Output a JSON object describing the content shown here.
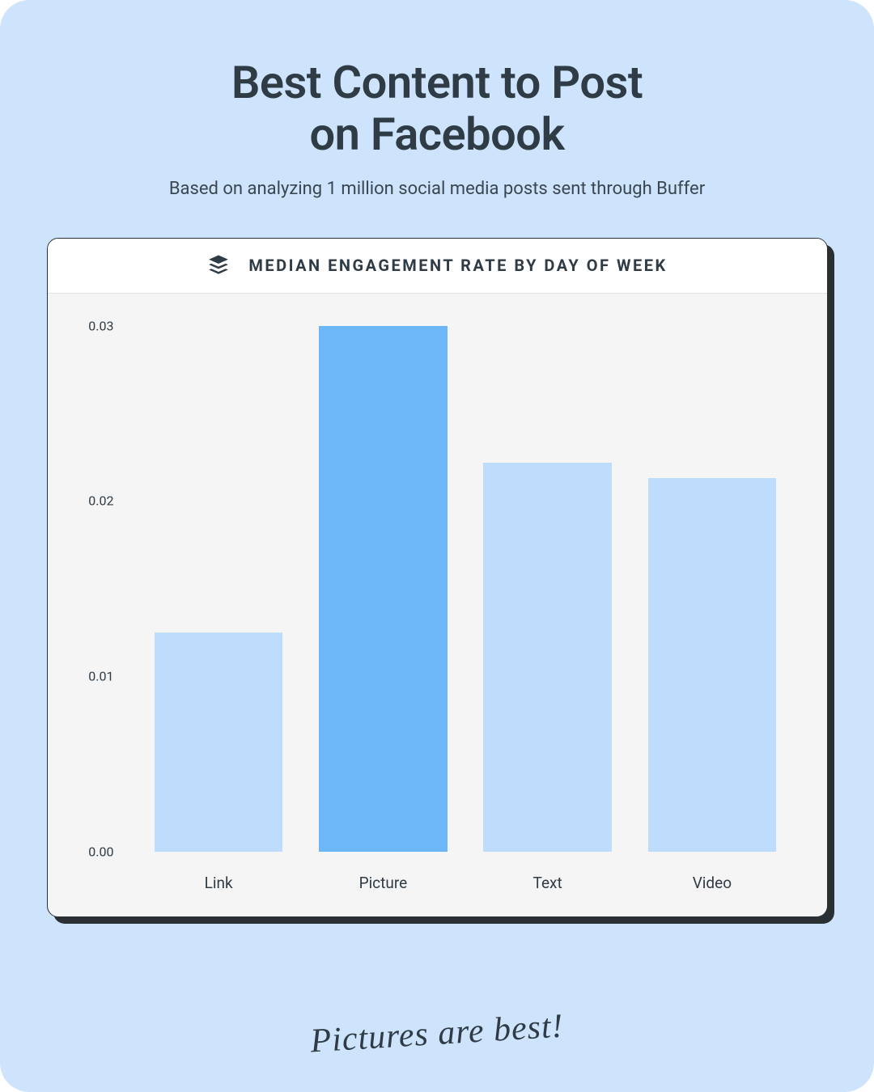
{
  "title_line1": "Best Content to Post",
  "title_line2": "on Facebook",
  "subtitle": "Based on analyzing 1 million social media posts sent through Buffer",
  "card_title": "MEDIAN ENGAGEMENT RATE BY DAY OF WEEK",
  "caption": "Pictures are best!",
  "colors": {
    "canvas_bg": "#cde4fc",
    "bar_light": "#bedcfb",
    "bar_highlight": "#6cb7f7",
    "text": "#2f3b45"
  },
  "chart_data": {
    "type": "bar",
    "title": "MEDIAN ENGAGEMENT RATE BY DAY OF WEEK",
    "xlabel": "",
    "ylabel": "",
    "ylim": [
      0.0,
      0.03
    ],
    "y_ticks": [
      0.0,
      0.01,
      0.02,
      0.03
    ],
    "y_tick_labels": [
      "0.00",
      "0.01",
      "0.02",
      "0.03"
    ],
    "categories": [
      "Link",
      "Picture",
      "Text",
      "Video"
    ],
    "values": [
      0.0125,
      0.0302,
      0.0222,
      0.0213
    ],
    "highlight_index": 1
  }
}
